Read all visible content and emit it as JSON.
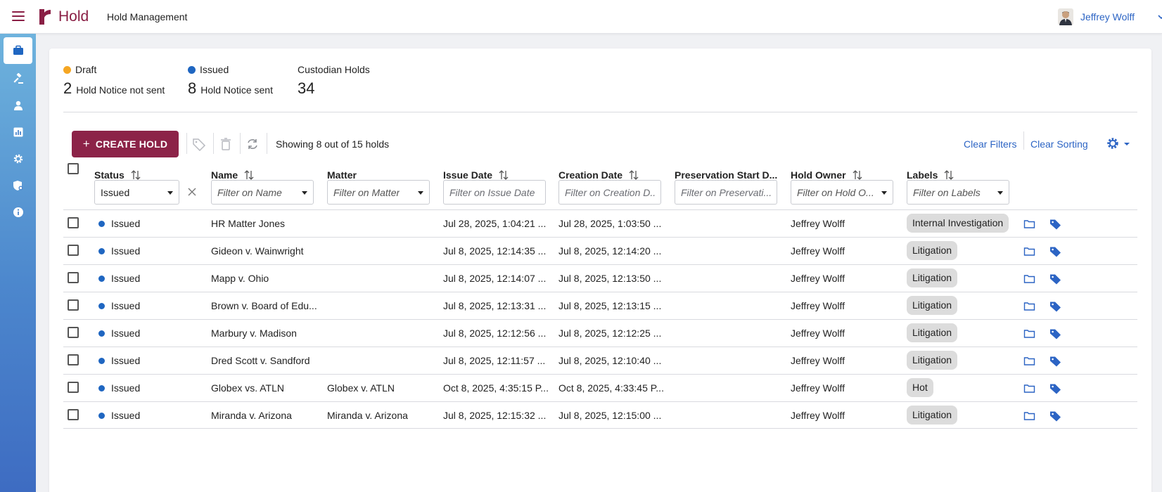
{
  "app": {
    "brand": "Hold",
    "page_title": "Hold Management",
    "user_name": "Jeffrey Wolff"
  },
  "sidebar": {
    "items": [
      {
        "icon": "briefcase-icon",
        "active": true
      },
      {
        "icon": "gavel-icon",
        "active": false
      },
      {
        "icon": "person-icon",
        "active": false
      },
      {
        "icon": "chart-icon",
        "active": false
      },
      {
        "icon": "gear-icon",
        "active": false
      },
      {
        "icon": "shield-gear-icon",
        "active": false
      },
      {
        "icon": "info-icon",
        "active": false
      }
    ]
  },
  "summary": {
    "draft": {
      "label": "Draft",
      "count": "2",
      "text": "Hold Notice not sent",
      "color": "#f5a623"
    },
    "issued": {
      "label": "Issued",
      "count": "8",
      "text": "Hold Notice sent",
      "color": "#1f66c1"
    },
    "custodian": {
      "label": "Custodian Holds",
      "count": "34"
    }
  },
  "toolbar": {
    "create_label": "CREATE HOLD",
    "showing": "Showing 8 out of 15 holds",
    "clear_filters": "Clear Filters",
    "clear_sorting": "Clear Sorting"
  },
  "table": {
    "columns": {
      "status": "Status",
      "name": "Name",
      "matter": "Matter",
      "issue_date": "Issue Date",
      "creation_date": "Creation Date",
      "preservation": "Preservation Start D...",
      "owner": "Hold Owner",
      "labels": "Labels"
    },
    "filters": {
      "status_value": "Issued",
      "name": "Filter on Name",
      "matter": "Filter on Matter",
      "issue_date": "Filter on Issue Date",
      "creation_date": "Filter on Creation D...",
      "preservation": "Filter on Preservati...",
      "owner": "Filter on Hold O...",
      "labels": "Filter on Labels"
    },
    "rows": [
      {
        "status": "Issued",
        "name": "HR Matter Jones",
        "matter": "",
        "issue_date": "Jul 28, 2025, 1:04:21 ...",
        "creation_date": "Jul 28, 2025, 1:03:50 ...",
        "preservation": "",
        "owner": "Jeffrey Wolff",
        "label": "Internal Investigation"
      },
      {
        "status": "Issued",
        "name": "Gideon v. Wainwright",
        "matter": "",
        "issue_date": "Jul 8, 2025, 12:14:35 ...",
        "creation_date": "Jul 8, 2025, 12:14:20 ...",
        "preservation": "",
        "owner": "Jeffrey Wolff",
        "label": "Litigation"
      },
      {
        "status": "Issued",
        "name": "Mapp v. Ohio",
        "matter": "",
        "issue_date": "Jul 8, 2025, 12:14:07 ...",
        "creation_date": "Jul 8, 2025, 12:13:50 ...",
        "preservation": "",
        "owner": "Jeffrey Wolff",
        "label": "Litigation"
      },
      {
        "status": "Issued",
        "name": "Brown v. Board of Edu...",
        "matter": "",
        "issue_date": "Jul 8, 2025, 12:13:31 ...",
        "creation_date": "Jul 8, 2025, 12:13:15 ...",
        "preservation": "",
        "owner": "Jeffrey Wolff",
        "label": "Litigation"
      },
      {
        "status": "Issued",
        "name": "Marbury v. Madison",
        "matter": "",
        "issue_date": "Jul 8, 2025, 12:12:56 ...",
        "creation_date": "Jul 8, 2025, 12:12:25 ...",
        "preservation": "",
        "owner": "Jeffrey Wolff",
        "label": "Litigation"
      },
      {
        "status": "Issued",
        "name": "Dred Scott v. Sandford",
        "matter": "",
        "issue_date": "Jul 8, 2025, 12:11:57 ...",
        "creation_date": "Jul 8, 2025, 12:10:40 ...",
        "preservation": "",
        "owner": "Jeffrey Wolff",
        "label": "Litigation"
      },
      {
        "status": "Issued",
        "name": "Globex vs. ATLN",
        "matter": "Globex v. ATLN",
        "issue_date": "Oct 8, 2025, 4:35:15 P...",
        "creation_date": "Oct 8, 2025, 4:33:45 P...",
        "preservation": "",
        "owner": "Jeffrey Wolff",
        "label": "Hot"
      },
      {
        "status": "Issued",
        "name": "Miranda v. Arizona",
        "matter": "Miranda v. Arizona",
        "issue_date": "Jul 8, 2025, 12:15:32 ...",
        "creation_date": "Jul 8, 2025, 12:15:00 ...",
        "preservation": "",
        "owner": "Jeffrey Wolff",
        "label": "Litigation"
      }
    ]
  },
  "colors": {
    "brand": "#8c2348",
    "link": "#2c64c4",
    "issued": "#1f66c1",
    "draft": "#f5a623"
  }
}
